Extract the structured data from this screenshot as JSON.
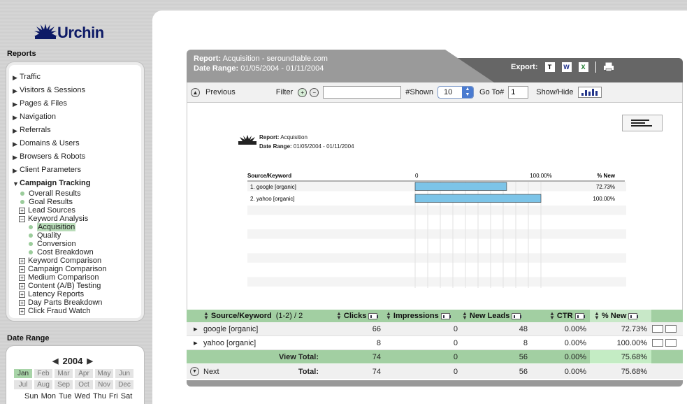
{
  "app": {
    "logo_text": "Urchin"
  },
  "sidebar": {
    "reports_heading": "Reports",
    "nav_items": [
      {
        "label": "Traffic"
      },
      {
        "label": "Visitors & Sessions"
      },
      {
        "label": "Pages & Files"
      },
      {
        "label": "Navigation"
      },
      {
        "label": "Referrals"
      },
      {
        "label": "Domains & Users"
      },
      {
        "label": "Browsers & Robots"
      },
      {
        "label": "Client Parameters"
      },
      {
        "label": "Campaign Tracking"
      }
    ],
    "campaign_sub": {
      "overall_results": "Overall Results",
      "goal_results": "Goal Results",
      "lead_sources": "Lead Sources",
      "keyword_analysis": "Keyword Analysis",
      "acquisition": "Acquisition",
      "quality": "Quality",
      "conversion": "Conversion",
      "cost_breakdown": "Cost Breakdown",
      "keyword_comparison": "Keyword Comparison",
      "campaign_comparison": "Campaign Comparison",
      "medium_comparison": "Medium Comparison",
      "content_testing": "Content (A/B) Testing",
      "latency_reports": "Latency Reports",
      "day_parts": "Day Parts Breakdown",
      "click_fraud": "Click Fraud Watch"
    },
    "date_range_heading": "Date Range",
    "year": "2004",
    "months_row1": [
      "Jan",
      "Feb",
      "Mar",
      "Apr",
      "May",
      "Jun"
    ],
    "months_row2": [
      "Jul",
      "Aug",
      "Sep",
      "Oct",
      "Nov",
      "Dec"
    ],
    "weekdays": [
      "Sun",
      "Mon",
      "Tue",
      "Wed",
      "Thu",
      "Fri",
      "Sat"
    ]
  },
  "report": {
    "report_label": "Report:",
    "report_value": "Acquisition - seroundtable.com",
    "range_label": "Date Range:",
    "range_value": "01/05/2004 - 01/11/2004",
    "export_label": "Export:",
    "export_buttons": {
      "t": "T",
      "w": "W",
      "x": "X"
    }
  },
  "toolbar": {
    "previous": "Previous",
    "filter_label": "Filter",
    "filter_value": "",
    "shown_label": "#Shown",
    "shown_value": "10",
    "goto_label": "Go To#",
    "goto_value": "1",
    "showhide_label": "Show/Hide"
  },
  "chart_meta": {
    "report_label": "Report:",
    "report_value": "Acquisition",
    "range_label": "Date Range:",
    "range_value": "01/05/2004 - 01/11/2004"
  },
  "chart_data": {
    "type": "bar",
    "orientation": "horizontal",
    "column_header": "Source/Keyword",
    "value_header": "% New",
    "axis_min_label": "0",
    "axis_max_label": "100.00%",
    "xlim": [
      0,
      100
    ],
    "categories": [
      "1. google [organic]",
      "2. yahoo [organic]"
    ],
    "values": [
      72.73,
      100.0
    ],
    "value_labels": [
      "72.73%",
      "100.00%"
    ],
    "bar_color": "#7cc4e8",
    "empty_rows": 8
  },
  "table": {
    "headers": {
      "source_keyword": "Source/Keyword",
      "count": "(1-2) / 2",
      "clicks": "Clicks",
      "impressions": "Impressions",
      "new_leads": "New Leads",
      "ctr": "CTR",
      "pct_new": "% New"
    },
    "rows": [
      {
        "keyword": "google [organic]",
        "clicks": "66",
        "impressions": "0",
        "new_leads": "48",
        "ctr": "0.00%",
        "pct_new": "72.73%"
      },
      {
        "keyword": "yahoo [organic]",
        "clicks": "8",
        "impressions": "0",
        "new_leads": "8",
        "ctr": "0.00%",
        "pct_new": "100.00%"
      }
    ],
    "view_total": {
      "label": "View Total:",
      "clicks": "74",
      "impressions": "0",
      "new_leads": "56",
      "ctr": "0.00%",
      "pct_new": "75.68%"
    },
    "total": {
      "label": "Total:",
      "clicks": "74",
      "impressions": "0",
      "new_leads": "56",
      "ctr": "0.00%",
      "pct_new": "75.68%"
    },
    "next_label": "Next"
  }
}
